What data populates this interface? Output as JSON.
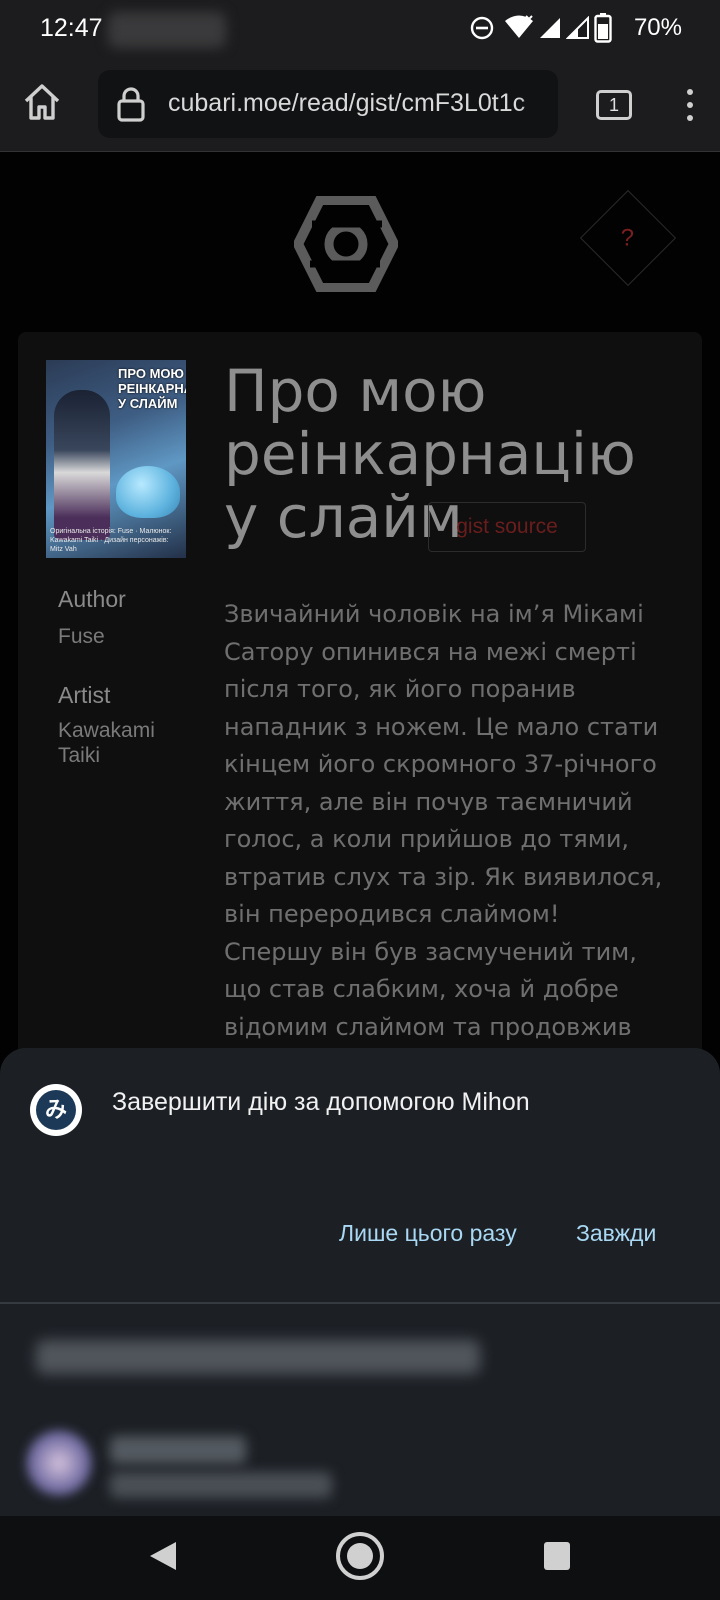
{
  "status_bar": {
    "time": "12:47",
    "battery": "70%",
    "icons": [
      "dnd-icon",
      "wifi-icon",
      "signal-icon",
      "signal-icon",
      "battery-icon"
    ]
  },
  "browser": {
    "url": "cubari.moe/read/gist/cmF3L0t1c",
    "tab_count": "1",
    "icons": [
      "home-icon",
      "lock-icon",
      "tabs-icon",
      "more-vert-icon"
    ]
  },
  "page": {
    "help_symbol": "?",
    "title": "Про мою реінкарнацію у слайм",
    "source_badge": "gist source",
    "author_label": "Author",
    "author": "Fuse",
    "artist_label": "Artist",
    "artist": "Kawakami Taiki",
    "description": "Звичайний чоловік на ім’я Мікамі Сатору опинився на межі смерті після того, як його поранив нападник з ножем. Це мало стати кінцем його скромного 37-річного життя, але він почув таємничий голос, а коли прийшов до тями, втратив слух та зір. Як виявилося, він переродився слаймом! Спершу він був засмучений тим, що став слабким, хоча й добре відомим слаймом та продовжив",
    "cover": {
      "title": "ПРО МОЮ РЕІНКАРНАЦІЮ У СЛАЙМ",
      "footer": "Оригінальна історія: Fuse · Малюнок: Kawakami Taiki · Дизайн персонажів: Mitz Vah"
    }
  },
  "sheet": {
    "app_glyph": "み",
    "title": "Завершити дію за допомогою Mihon",
    "once_button": "Лише цього разу",
    "always_button": "Завжди"
  },
  "colors": {
    "accent_link": "#a8d8f3",
    "sheet_bg": "#1c2025",
    "badge_red": "#6a1d1d"
  }
}
